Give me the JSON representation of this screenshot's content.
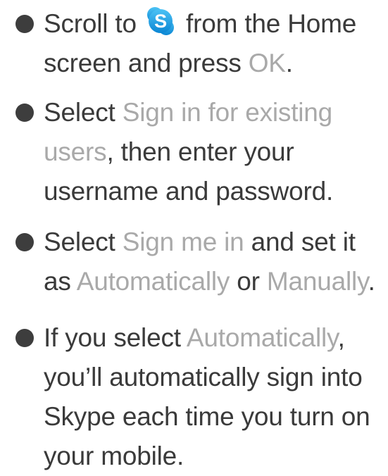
{
  "items": [
    {
      "t1": "Scroll to",
      "icon": "skype-icon",
      "t2": "from the Home screen and press",
      "t3": "OK",
      "t4": "."
    },
    {
      "t1": "Select",
      "t2": "Sign in for existing users",
      "t3": ", then enter your username and password."
    },
    {
      "t1": "Select",
      "t2": "Sign me in",
      "t3": "and set it as",
      "t4": "Automatically",
      "t5": "or",
      "t6": "Manually",
      "t7": "."
    },
    {
      "t1": "If you select",
      "t2": "Automatically",
      "t3": ", you’ll automatically sign into Skype each time you turn on your mobile."
    }
  ],
  "colors": {
    "text": "#3a3a3a",
    "highlight": "#a9a9a9",
    "bullet": "#3d3d3d",
    "skype_blue": "#1aa0e6"
  }
}
